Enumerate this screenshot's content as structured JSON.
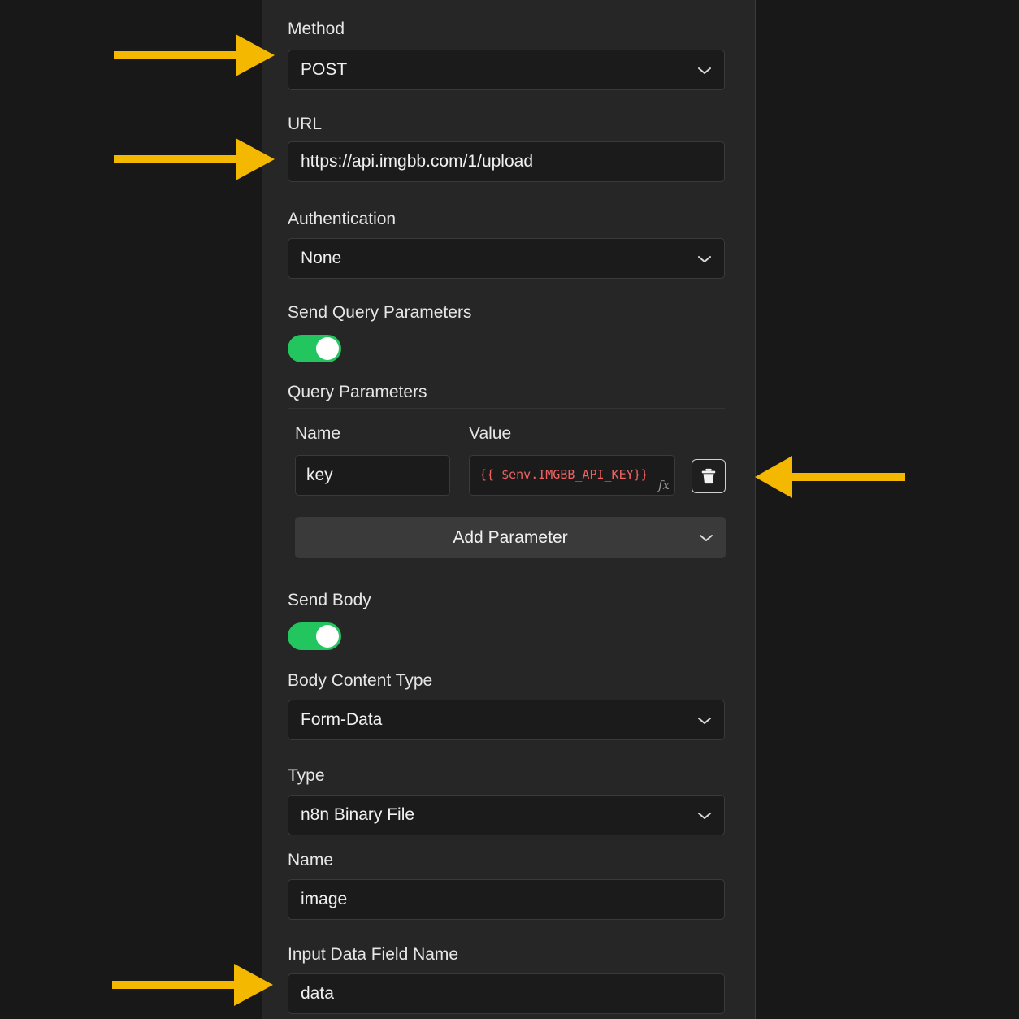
{
  "method": {
    "label": "Method",
    "value": "POST"
  },
  "url": {
    "label": "URL",
    "value": "https://api.imgbb.com/1/upload"
  },
  "authentication": {
    "label": "Authentication",
    "value": "None"
  },
  "send_query": {
    "label": "Send Query Parameters",
    "enabled": true
  },
  "query_params": {
    "label": "Query Parameters",
    "name_header": "Name",
    "value_header": "Value",
    "rows": [
      {
        "name": "key",
        "value": "{{ $env.IMGBB_API_KEY}}",
        "expression_badge": "fx"
      }
    ],
    "add_label": "Add Parameter"
  },
  "send_body": {
    "label": "Send Body",
    "enabled": true
  },
  "body_content_type": {
    "label": "Body Content Type",
    "value": "Form-Data"
  },
  "type": {
    "label": "Type",
    "value": "n8n Binary File"
  },
  "name_field": {
    "label": "Name",
    "value": "image"
  },
  "input_field": {
    "label": "Input Data Field Name",
    "value": "data"
  },
  "colors": {
    "background": "#181818",
    "panel": "#262626",
    "toggle_on": "#22c55e",
    "arrow": "#f5b800",
    "expression": "#f06262"
  },
  "icons": {
    "dropdown": "chevron-down-icon",
    "delete": "trash-icon",
    "annotation": "arrow-icon"
  }
}
